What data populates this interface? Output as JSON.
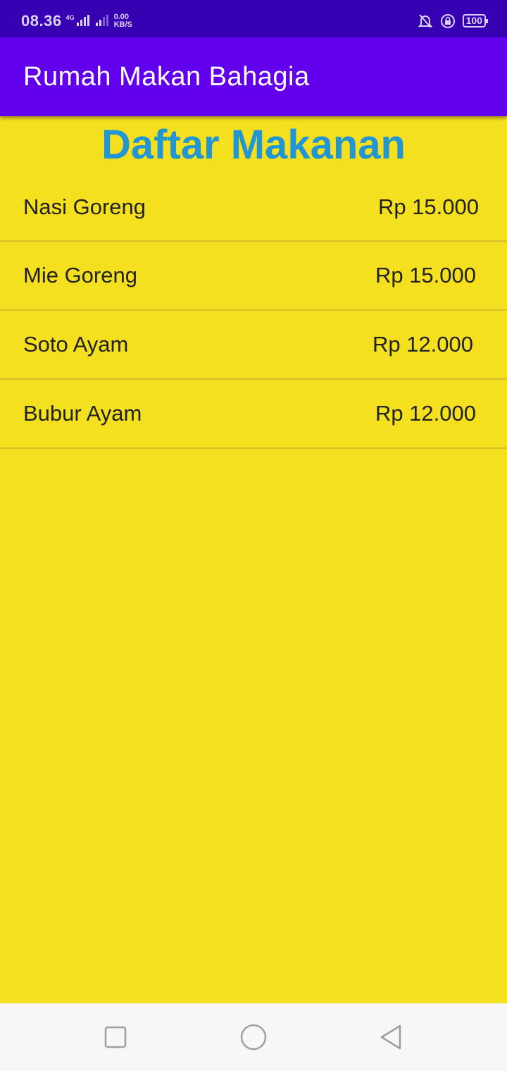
{
  "status_bar": {
    "time": "08.36",
    "network_type": "4G",
    "speed_value": "0.00",
    "speed_unit": "KB/S",
    "battery": "100",
    "icons": [
      "mute-bell-icon",
      "rotation-lock-icon",
      "battery-icon"
    ]
  },
  "app_bar": {
    "title": "Rumah Makan Bahagia"
  },
  "heading": "Daftar Makanan",
  "menu": [
    {
      "name": "Nasi Goreng",
      "price": "Rp 15.000"
    },
    {
      "name": "Mie Goreng",
      "price": "Rp 15.000"
    },
    {
      "name": "Soto Ayam",
      "price": "Rp 12.000"
    },
    {
      "name": "Bubur Ayam",
      "price": "Rp 12.000"
    }
  ],
  "nav_bar": {
    "buttons": [
      "recents-button",
      "home-button",
      "back-button"
    ]
  },
  "colors": {
    "status_bar": "#3700b3",
    "app_bar": "#6200ee",
    "background": "#f4e01e",
    "heading": "#2196d3"
  }
}
